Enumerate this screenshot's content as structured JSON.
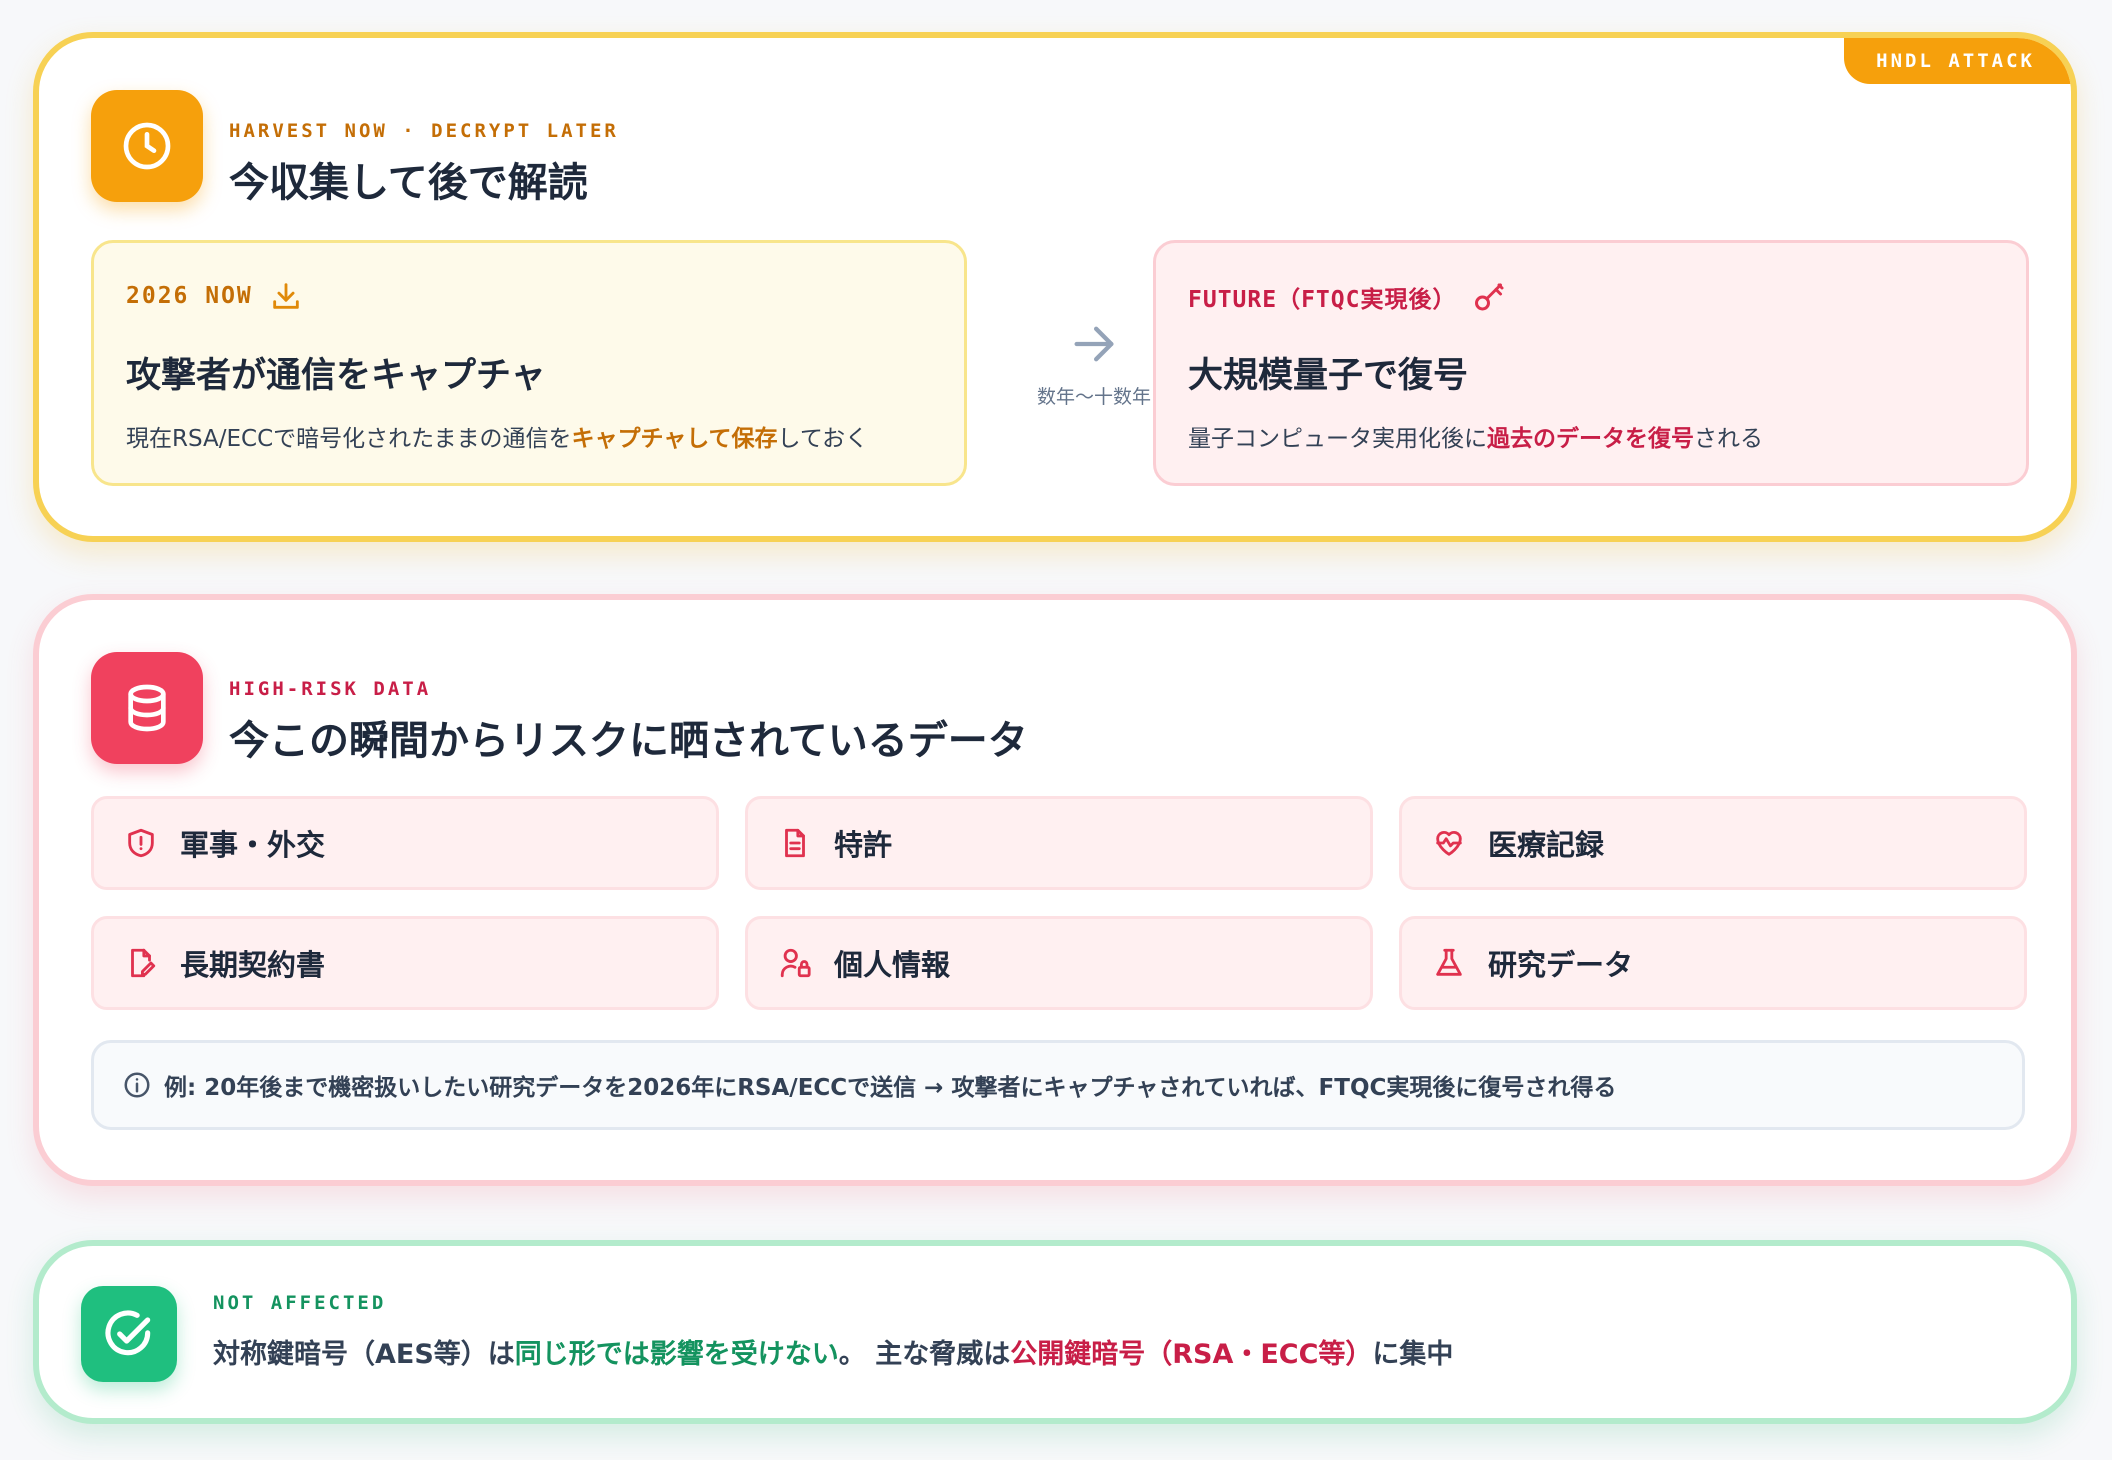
{
  "hndl": {
    "tag": "HNDL ATTACK",
    "kicker": "HARVEST NOW · DECRYPT LATER",
    "title": "今収集して後で解読",
    "now": {
      "head": "2026 NOW",
      "title": "攻撃者が通信をキャプチャ",
      "desc_pre": "現在RSA/ECCで暗号化されたままの通信を",
      "desc_em": "キャプチャして保存",
      "desc_post": "しておく"
    },
    "arrow_label": "数年〜十数年",
    "future": {
      "head": "FUTURE（FTQC実現後）",
      "title": "大規模量子で復号",
      "desc_pre": "量子コンピュータ実用化後に",
      "desc_em": "過去のデータを復号",
      "desc_post": "される"
    }
  },
  "risk": {
    "kicker": "HIGH-RISK DATA",
    "title": "今この瞬間からリスクに晒されているデータ",
    "items": [
      {
        "label": "軍事・外交",
        "icon": "shield-alert-icon"
      },
      {
        "label": "特許",
        "icon": "document-icon"
      },
      {
        "label": "医療記録",
        "icon": "heart-pulse-icon"
      },
      {
        "label": "長期契約書",
        "icon": "file-signature-icon"
      },
      {
        "label": "個人情報",
        "icon": "user-lock-icon"
      },
      {
        "label": "研究データ",
        "icon": "flask-icon"
      }
    ],
    "note": "例: 20年後まで機密扱いしたい研究データを2026年にRSA/ECCで送信 → 攻撃者にキャプチャされていれば、FTQC実現後に復号され得る"
  },
  "safe": {
    "kicker": "NOT AFFECTED",
    "text_pre": "対称鍵暗号（AES等）は",
    "text_green": "同じ形では影響を受けない",
    "text_mid": "。 主な脅威は",
    "text_red": "公開鍵暗号（RSA・ECC等）",
    "text_post": "に集中"
  },
  "colors": {
    "amber": "#f6a00c",
    "amber_text": "#c46e06",
    "red": "#f0415e",
    "red_text": "#c81e47",
    "green": "#1fbf7f",
    "green_text": "#14935f"
  }
}
